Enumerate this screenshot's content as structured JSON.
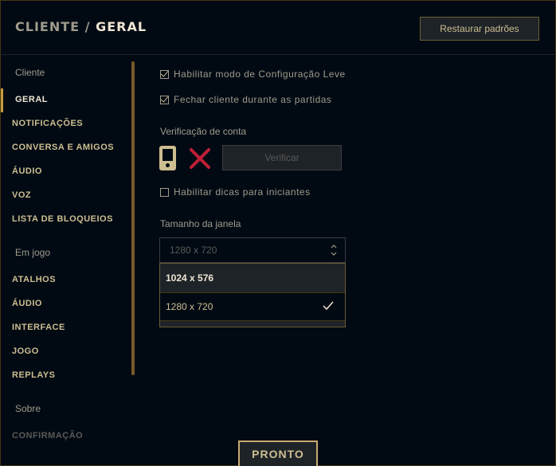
{
  "header": {
    "breadcrumb_parent": "CLIENTE",
    "breadcrumb_separator": "/",
    "breadcrumb_current": "GERAL",
    "restore_label": "Restaurar padrões"
  },
  "sidebar": {
    "section_client": "Cliente",
    "client_items": [
      "GERAL",
      "NOTIFICAÇÕES",
      "CONVERSA E AMIGOS",
      "ÁUDIO",
      "VOZ",
      "LISTA DE BLOQUEIOS"
    ],
    "active_item": "GERAL",
    "section_ingame": "Em jogo",
    "ingame_items": [
      "ATALHOS",
      "ÁUDIO",
      "INTERFACE",
      "JOGO",
      "REPLAYS"
    ],
    "section_about": "Sobre",
    "about_items": [
      "CONFIRMAÇÃO"
    ]
  },
  "settings": {
    "lightweight_mode": {
      "label": "Habilitar modo de Configuração Leve",
      "checked": true
    },
    "close_client": {
      "label": "Fechar cliente durante as partidas",
      "checked": true
    },
    "account_verification_title": "Verificação de conta",
    "verify_label": "Verificar",
    "beginner_tips": {
      "label": "Habilitar dicas para iniciantes",
      "checked": false
    },
    "window_size_title": "Tamanho da janela",
    "window_size_value": "1280 x 720",
    "window_size_options": [
      "1024 x 576",
      "1280 x 720"
    ],
    "window_size_selected": "1280 x 720",
    "window_size_highlighted": "1024 x 576"
  },
  "footer": {
    "done_label": "PRONTO"
  },
  "colors": {
    "gold": "#c89b3c",
    "background": "#010a13",
    "error_red": "#be1e37"
  },
  "icons": [
    "mobile-phone-icon",
    "close-x-icon",
    "chevron-up-down-icon",
    "checkmark-icon"
  ]
}
